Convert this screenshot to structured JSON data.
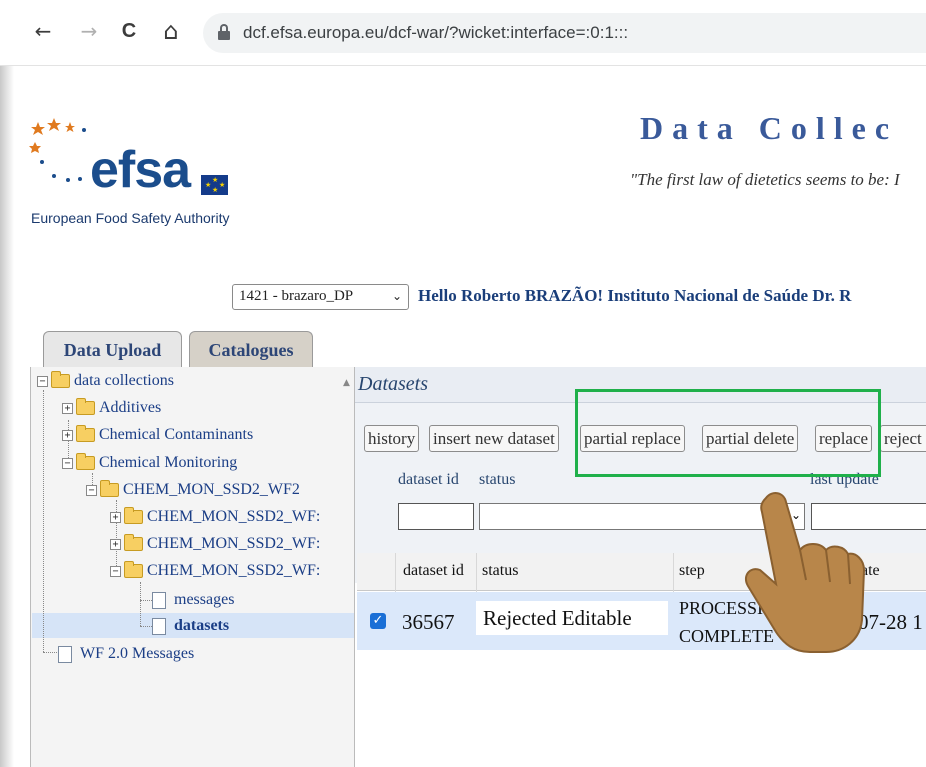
{
  "browser": {
    "back": "←",
    "forward": "→",
    "reload": "C",
    "home": "⌂",
    "url": "dcf.efsa.europa.eu/dcf-war/?wicket:interface=:0:1:::"
  },
  "header": {
    "logo_word": "efsa",
    "logo_subtitle": "European Food Safety Authority",
    "app_title": "Data Collec",
    "quote": "\"The first law of dietetics seems to be: I"
  },
  "user": {
    "selected_account": "1421 - brazaro_DP",
    "greeting": "Hello Roberto BRAZÃO! Instituto Nacional de Saúde Dr. R"
  },
  "tabs": [
    {
      "label": "Data Upload",
      "active": true
    },
    {
      "label": "Catalogues",
      "active": false
    }
  ],
  "tree": {
    "root": "data collections",
    "additives": "Additives",
    "chemical_contaminants": "Chemical Contaminants",
    "chemical_monitoring": "Chemical Monitoring",
    "wf_parent": "CHEM_MON_SSD2_WF2",
    "wf_child_1": "CHEM_MON_SSD2_WF:",
    "wf_child_2": "CHEM_MON_SSD2_WF:",
    "wf_child_3": "CHEM_MON_SSD2_WF:",
    "messages": "messages",
    "datasets": "datasets",
    "wf_messages": "WF 2.0 Messages"
  },
  "datasets_panel": {
    "title": "Datasets",
    "buttons": {
      "history": "history",
      "insert_new_dataset": "insert new dataset",
      "partial_replace": "partial replace",
      "partial_delete": "partial delete",
      "replace": "replace",
      "reject": "reject"
    },
    "filters": {
      "dataset_id_label": "dataset id",
      "status_label": "status",
      "last_update_label": "last update"
    },
    "columns": {
      "dataset_id": "dataset id",
      "status": "status",
      "step": "step",
      "date": "date"
    },
    "rows": [
      {
        "checked": true,
        "dataset_id": "36567",
        "status": "Rejected Editable",
        "step_line1": "PROCESSI",
        "step_line2": "COMPLETE",
        "date": "07-28 1"
      }
    ]
  },
  "colors": {
    "highlight": "#1fb04a",
    "hand": "#b8864a",
    "efsa_blue": "#1b4d8c",
    "star_orange": "#e07a1f"
  }
}
